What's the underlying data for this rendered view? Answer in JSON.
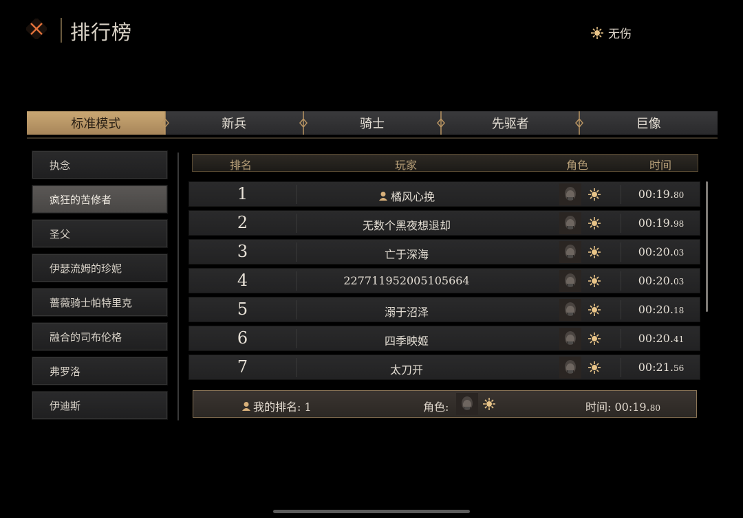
{
  "header": {
    "title": "排行榜",
    "flawless_label": "无伤",
    "close_icon": "close-x-icon",
    "flawless_icon": "sun-emblem-icon"
  },
  "tabs": [
    {
      "label": "标准模式",
      "active": true
    },
    {
      "label": "新兵",
      "active": false
    },
    {
      "label": "骑士",
      "active": false
    },
    {
      "label": "先驱者",
      "active": false
    },
    {
      "label": "巨像",
      "active": false
    }
  ],
  "sidebar": {
    "items": [
      {
        "label": "执念",
        "active": false
      },
      {
        "label": "疯狂的苦修者",
        "active": true
      },
      {
        "label": "圣父",
        "active": false
      },
      {
        "label": "伊瑟流姆的珍妮",
        "active": false
      },
      {
        "label": "蔷薇骑士帕特里克",
        "active": false
      },
      {
        "label": "融合的司布伦格",
        "active": false
      },
      {
        "label": "弗罗洛",
        "active": false
      },
      {
        "label": "伊迪斯",
        "active": false
      }
    ]
  },
  "table": {
    "columns": {
      "rank": "排名",
      "player": "玩家",
      "character": "角色",
      "time": "时间"
    },
    "rows": [
      {
        "rank": "1",
        "player": "橘风心挽",
        "self": true,
        "time_main": "00:19.",
        "time_ms": "80"
      },
      {
        "rank": "2",
        "player": "无数个黑夜想退却",
        "self": false,
        "time_main": "00:19.",
        "time_ms": "98"
      },
      {
        "rank": "3",
        "player": "亡于深海",
        "self": false,
        "time_main": "00:20.",
        "time_ms": "03"
      },
      {
        "rank": "4",
        "player": "227711952005105664",
        "self": false,
        "time_main": "00:20.",
        "time_ms": "03"
      },
      {
        "rank": "5",
        "player": "溺于沼泽",
        "self": false,
        "time_main": "00:20.",
        "time_ms": "18"
      },
      {
        "rank": "6",
        "player": "四季映姬",
        "self": false,
        "time_main": "00:20.",
        "time_ms": "41"
      },
      {
        "rank": "7",
        "player": "太刀开",
        "self": false,
        "time_main": "00:21.",
        "time_ms": "56"
      }
    ]
  },
  "my_rank": {
    "rank_label": "我的排名: 1",
    "character_label": "角色:",
    "time_label": "时间: 00:19.",
    "time_ms": "80"
  },
  "colors": {
    "accent_gold": "#c9a773",
    "emblem_gold": "#e8c488",
    "close_orange": "#e0703a"
  }
}
